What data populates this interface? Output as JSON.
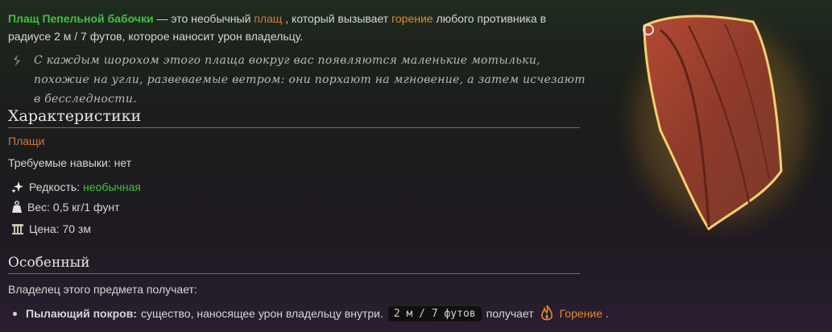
{
  "intro": {
    "item_name": "Плащ Пепельной бабочки",
    "text1": " — это необычный ",
    "category_link": "плащ",
    "text2": " , который вызывает ",
    "burn_link": "горение",
    "text3": " любого противника в радиусе 2 м / 7 футов, которое наносит урон владельцу."
  },
  "quote": "С каждым шорохом этого плаща вокруг вас появляются маленькие мотыльки, похожие на угли, развеваемые ветром: они порхают на мгновение, а затем исчезают в бесследности.",
  "characteristics": {
    "heading": "Характеристики",
    "category": "Плащи",
    "skills_label": "Требуемые навыки:",
    "skills_value": "нет",
    "rarity_label": "Редкость:",
    "rarity_value": "необычная",
    "weight": "Вес: 0,5 кг/1 фунт",
    "price": "Цена: 70 зм"
  },
  "special": {
    "heading": "Особенный",
    "owner_text": "Владелец этого предмета получает:",
    "bullet_name": "Пылающий покров:",
    "bullet_text": "существо, наносящее урон владельцу внутри.",
    "range_code": "2 м / 7 футов",
    "gets_text": "получает",
    "status_link": "Горение",
    "period": "."
  },
  "icons": {
    "quote": "quote-marker-icon",
    "rarity": "sparkle-icon",
    "weight": "weight-icon",
    "price": "coins-icon",
    "burning": "flame-icon"
  },
  "colors": {
    "item_name": "#40c040",
    "link": "#d2783a",
    "rarity": "#3cc23c",
    "burn": "#e2892c"
  }
}
